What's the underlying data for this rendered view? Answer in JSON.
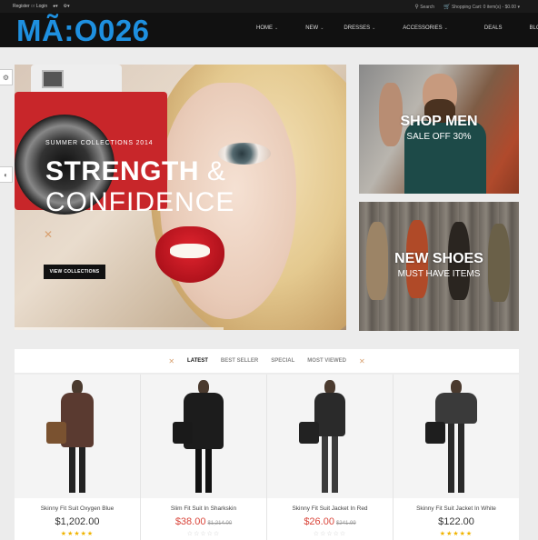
{
  "topbar": {
    "register": "Register",
    "or": "or",
    "login": "Login",
    "search": "Search",
    "cart": "Shopping Cart: 0 item(s) - $0.00"
  },
  "logo": "MÃ:O026",
  "nav": [
    {
      "label": "HOME",
      "has_chevron": true
    },
    {
      "label": "NEW",
      "has_chevron": true
    },
    {
      "label": "DRESSES",
      "has_chevron": true
    },
    {
      "label": "ACCESSORIES",
      "has_chevron": true
    },
    {
      "label": "DEALS",
      "has_chevron": false
    },
    {
      "label": "BLOG",
      "has_chevron": false
    }
  ],
  "hero": {
    "pretitle": "SUMMER COLLECTIONS 2014",
    "title_bold": "STRENGTH",
    "title_amp": "&",
    "title_2": "CONFIDENCE",
    "button": "VIEW COLLECTIONS"
  },
  "banners": {
    "men": {
      "title": "SHOP MEN",
      "subtitle": "SALE OFF 30%"
    },
    "shoes": {
      "title": "NEW SHOES",
      "subtitle": "MUST HAVE ITEMS"
    }
  },
  "tabs": [
    {
      "label": "LATEST",
      "active": true
    },
    {
      "label": "BEST SELLER",
      "active": false
    },
    {
      "label": "SPECIAL",
      "active": false
    },
    {
      "label": "MOST VIEWED",
      "active": false
    }
  ],
  "products": [
    {
      "name": "Skinny Fit Suit Oxygen Blue",
      "price": "$1,202.00",
      "old_price": "",
      "rating": 5
    },
    {
      "name": "Slim Fit Suit In Sharkskin",
      "price": "$38.00",
      "old_price": "$1,214.00",
      "rating": 0
    },
    {
      "name": "Skinny Fit Suit Jacket In Red",
      "price": "$26.00",
      "old_price": "$241.99",
      "rating": 0
    },
    {
      "name": "Skinny Fit Suit Jacket In White",
      "price": "$122.00",
      "old_price": "",
      "rating": 5
    }
  ],
  "colors": {
    "logo": "#1e90e0",
    "header_bg": "#111111",
    "sale_price": "#d9453a",
    "star": "#f0b400",
    "accent": "#d8a070"
  },
  "icons": {
    "settings": "gear-icon",
    "contrast": "contrast-icon",
    "search": "search-icon",
    "cart": "cart-icon",
    "user": "user-icon"
  }
}
